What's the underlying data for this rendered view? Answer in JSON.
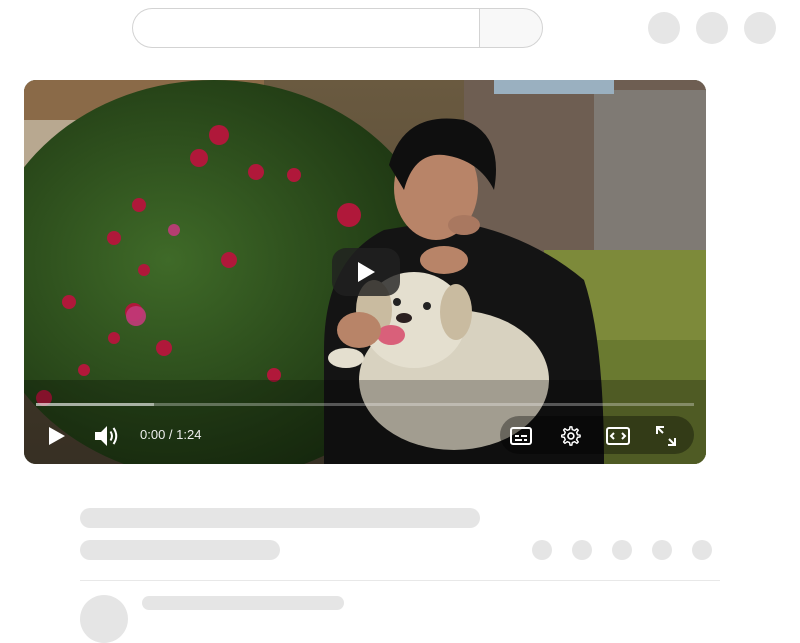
{
  "header": {
    "search_placeholder": ""
  },
  "player": {
    "time_current": "0:00",
    "time_separator": " / ",
    "time_total": "1:24",
    "buffered_fraction": 0.18
  },
  "icons": {
    "play": "play-icon",
    "volume": "volume-icon",
    "captions": "captions-icon",
    "settings": "gear-icon",
    "theater": "theater-mode-icon",
    "fullscreen": "fullscreen-icon"
  }
}
